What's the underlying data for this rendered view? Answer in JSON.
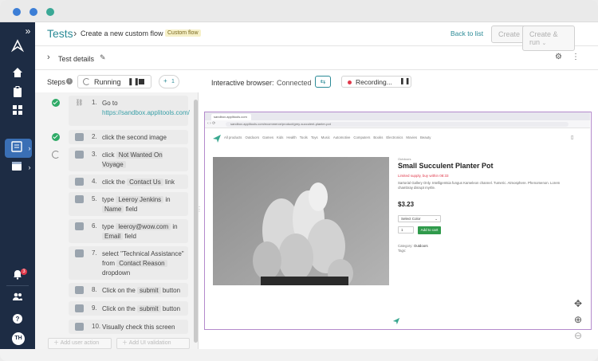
{
  "header": {
    "breadcrumb_root": "Tests",
    "title": "Create a new custom flow",
    "badge": "Custom flow",
    "back_label": "Back to list",
    "create_label": "Create",
    "create_run_label": "Create & run"
  },
  "details": {
    "label": "Test details"
  },
  "toolbar": {
    "steps_label": "Steps",
    "running_label": "Running",
    "add_count": "1",
    "browser_label": "Interactive browser:",
    "browser_status": "Connected",
    "recording_label": "Recording..."
  },
  "steps": [
    {
      "num": "1.",
      "text": "Go to",
      "link": "https://sandbox.applitools.com/"
    },
    {
      "num": "2.",
      "text": "click the second image"
    },
    {
      "num": "3.",
      "pre": "click",
      "chip": "Not Wanted On Voyage"
    },
    {
      "num": "4.",
      "pre": "click the",
      "chip": "Contact Us",
      "post": "link"
    },
    {
      "num": "5.",
      "pre": "type",
      "chip": "Leeroy Jenkins",
      "mid": "in",
      "chip2": "Name",
      "post": "field"
    },
    {
      "num": "6.",
      "pre": "type",
      "chip": "leeroy@wow.com",
      "mid": "in",
      "chip2": "Email",
      "post": "field"
    },
    {
      "num": "7.",
      "pre": "select \"Technical Assistance\" from",
      "chip": "Contact Reason",
      "post": "dropdown"
    },
    {
      "num": "8.",
      "pre": "Click on the",
      "chip": "submit",
      "post": "button"
    },
    {
      "num": "9.",
      "pre": "Click on the",
      "chip": "submit",
      "post": "button"
    },
    {
      "num": "10.",
      "text": "Visually check this screen"
    }
  ],
  "footer": {
    "add_action": "Add user action",
    "add_validation": "Add UI validation"
  },
  "site": {
    "url": "sandbox.applitools.com/ecommerce/product/grey-succulent-planter-pot",
    "tab_title": "sandbox.applitools.com",
    "nav": [
      "All products",
      "Outdoors",
      "Games",
      "Kids",
      "Health",
      "Tools",
      "Toys",
      "Music",
      "Automotive",
      "Computers",
      "Books",
      "Electronics",
      "Movies",
      "Beauty"
    ],
    "category": "Outdoors",
    "product_title": "Small Succulent Planter Pot",
    "limited": "Limited supply, buy within 08:33",
    "description": "Sartorial Gallery Only. Intelligentsia fungus Kameleon channel. Tumeric. Atmosphere. Phenomenon. Lorem chambray disrupt myrtle.",
    "price": "$3.23",
    "select_color": "Select Color",
    "qty": "1",
    "add_to_cart": "Add to cart",
    "category_label": "Category:",
    "category_value": "Outdoors",
    "tags_label": "Tags:"
  },
  "user": {
    "initials": "TH",
    "notifications": "3"
  },
  "colors": {
    "sidebar": "#1d2c44",
    "accent": "#2a8a96",
    "active": "#3a6fb5",
    "success": "#2eaa66",
    "recording": "#e0384a",
    "cart": "#2f9a4b"
  }
}
